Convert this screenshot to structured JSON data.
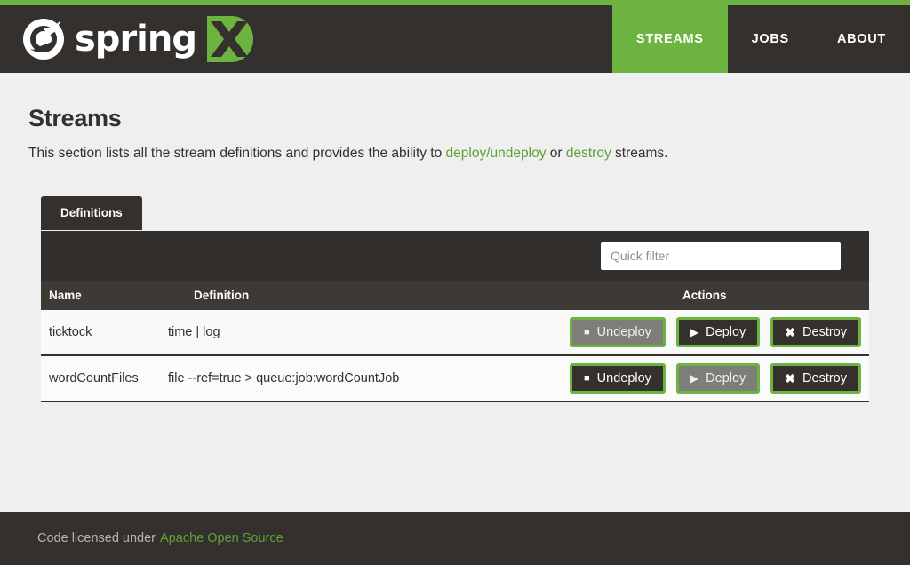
{
  "theme": {
    "brand_green": "#6db33f",
    "link_green": "#5fa134",
    "dark": "#34302d",
    "toolbar_dark": "#332f2d",
    "col_head_dark": "#3d3935",
    "page_bg": "#efefef",
    "disabled_gray": "#7d7d7a"
  },
  "header": {
    "brand_name": "spring",
    "brand_badge": "XD",
    "logo_icon": "spring-leaf-icon",
    "nav": [
      {
        "label": "STREAMS",
        "active": true,
        "name": "nav-item-streams"
      },
      {
        "label": "JOBS",
        "active": false,
        "name": "nav-item-jobs"
      },
      {
        "label": "ABOUT",
        "active": false,
        "name": "nav-item-about"
      }
    ]
  },
  "main": {
    "title": "Streams",
    "subtitle": {
      "part1": "This section lists all the stream definitions and provides the ability to ",
      "link1": "deploy/undeploy",
      "part2": " or ",
      "link2": "destroy",
      "part3": " streams."
    },
    "tabs": [
      {
        "label": "Definitions",
        "active": true,
        "name": "tab-definitions"
      }
    ],
    "filter": {
      "value": "",
      "placeholder": "Quick filter"
    },
    "table": {
      "columns": [
        "Name",
        "Definition",
        "Actions"
      ],
      "rows": [
        {
          "name": "ticktock",
          "definition": "time | log",
          "actions": [
            {
              "label": "Undeploy",
              "icon": "stop-icon",
              "glyph": "■",
              "disabled": true,
              "name": "undeploy-button"
            },
            {
              "label": "Deploy",
              "icon": "play-icon",
              "glyph": "▶",
              "disabled": false,
              "name": "deploy-button"
            },
            {
              "label": "Destroy",
              "icon": "close-icon",
              "glyph": "✖",
              "disabled": false,
              "name": "destroy-button"
            }
          ]
        },
        {
          "name": "wordCountFiles",
          "definition": "file --ref=true > queue:job:wordCountJob",
          "actions": [
            {
              "label": "Undeploy",
              "icon": "stop-icon",
              "glyph": "■",
              "disabled": false,
              "name": "undeploy-button"
            },
            {
              "label": "Deploy",
              "icon": "play-icon",
              "glyph": "▶",
              "disabled": true,
              "name": "deploy-button"
            },
            {
              "label": "Destroy",
              "icon": "close-icon",
              "glyph": "✖",
              "disabled": false,
              "name": "destroy-button"
            }
          ]
        }
      ]
    }
  },
  "footer": {
    "text": "Code licensed under",
    "link": "Apache Open Source"
  }
}
